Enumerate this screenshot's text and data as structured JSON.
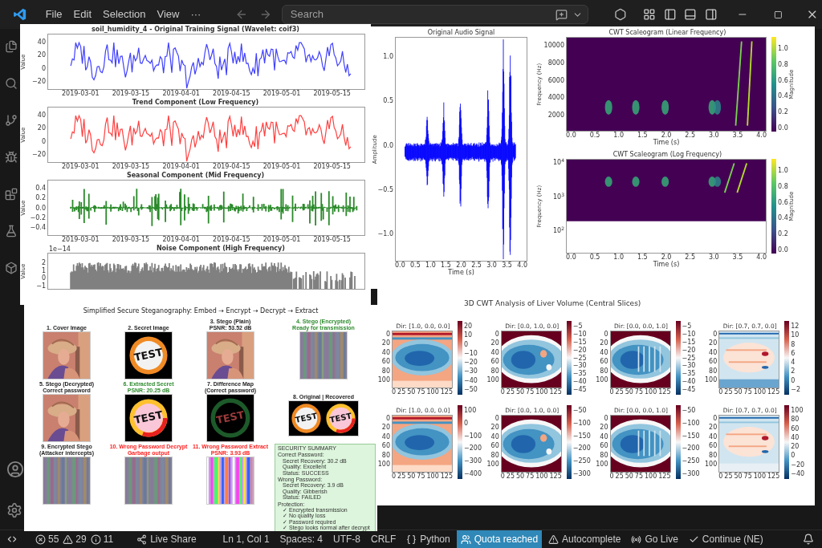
{
  "title_bar": {
    "menu": [
      "File",
      "Edit",
      "Selection",
      "View",
      "···"
    ],
    "search": {
      "placeholder": "Search"
    }
  },
  "decomposition_figure": {
    "panels": [
      {
        "title": "soil_humidity_4 - Original Training Signal (Wavelet: coif3)",
        "ylabel": "Value",
        "color": "#4040ff",
        "yticks": [
          "40",
          "20",
          "0",
          "−20"
        ],
        "xticks": [
          "2019-03-01",
          "2019-03-15",
          "2019-04-01",
          "2019-04-15",
          "2019-05-01",
          "2019-05-15"
        ]
      },
      {
        "title": "Trend Component (Low Frequency)",
        "ylabel": "Value",
        "color": "#ff4040",
        "yticks": [
          "40",
          "20",
          "0",
          "−20"
        ],
        "xticks": [
          "2019-03-01",
          "2019-03-15",
          "2019-04-01",
          "2019-04-15",
          "2019-05-01",
          "2019-05-15"
        ]
      },
      {
        "title": "Seasonal Component (Mid Frequency)",
        "ylabel": "Value",
        "color": "#2a8a2a",
        "yticks": [
          "0.4",
          "0.2",
          "0.0",
          "−0.2",
          "−0.4"
        ],
        "xticks": [
          "2019-03-01",
          "2019-03-15",
          "2019-04-01",
          "2019-04-15",
          "2019-05-01",
          "2019-05-15"
        ]
      },
      {
        "title": "Noise Component (High Frequency)",
        "ylabel": "Value",
        "color": "#808080",
        "offset_label": "1e−14",
        "yticks": [
          "2",
          "1",
          "0",
          "−1"
        ]
      }
    ]
  },
  "audio_figure": {
    "signal": {
      "title": "Original Audio Signal",
      "ylabel": "Amplitude",
      "xlabel": "Time (s)",
      "yticks": [
        "1.0",
        "0.5",
        "0.0",
        "−0.5",
        "−1.0"
      ],
      "xticks": [
        "0.0",
        "0.5",
        "1.0",
        "1.5",
        "2.0",
        "2.5",
        "3.0",
        "3.5",
        "4.0"
      ]
    },
    "scaleograms": [
      {
        "kind": "linear",
        "title": "CWT Scaleogram (Linear Frequency)",
        "ylabel": "Frequency (Hz)",
        "xlabel": "Time (s)",
        "yticks": [
          "10000",
          "8000",
          "6000",
          "4000",
          "2000"
        ],
        "xticks": [
          "0.0",
          "0.5",
          "1.0",
          "1.5",
          "2.0",
          "2.5",
          "3.0",
          "3.5",
          "4.0"
        ],
        "colorbar": {
          "label": "Magnitude",
          "ticks": [
            "1.0",
            "0.8",
            "0.6",
            "0.4",
            "0.2",
            "0.0"
          ]
        }
      },
      {
        "kind": "log",
        "title": "CWT Scaleogram (Log Frequency)",
        "ylabel": "Frequency (Hz)",
        "xlabel": "Time (s)",
        "yticks": [
          "10$^{4}$",
          "10$^{3}$",
          "10$^{2}$"
        ],
        "xticks": [
          "0.0",
          "0.5",
          "1.0",
          "1.5",
          "2.0",
          "2.5",
          "3.0",
          "3.5",
          "4.0"
        ],
        "colorbar": {
          "label": "Magnitude",
          "ticks": [
            "1.0",
            "0.8",
            "0.6",
            "0.4",
            "0.2",
            "0.0"
          ]
        }
      }
    ]
  },
  "cwt_3d_figure": {
    "title": "3D CWT Analysis of Liver Volume (Central Slices)",
    "panels": [
      {
        "title": "Dir: [1.0, 0.0, 0.0]",
        "yticks": [
          "0",
          "20",
          "40",
          "60",
          "80",
          "100"
        ],
        "xticks": [
          "0",
          "25",
          "50",
          "75",
          "100",
          "125"
        ],
        "colorbar": [
          "20",
          "10",
          "0",
          "−10",
          "−20",
          "−30",
          "−40",
          "−50"
        ]
      },
      {
        "title": "Dir: [0.0, 1.0, 0.0]",
        "yticks": [
          "0",
          "20",
          "40",
          "60",
          "80",
          "100"
        ],
        "xticks": [
          "0",
          "25",
          "50",
          "75",
          "100",
          "125"
        ],
        "colorbar": [
          "−5",
          "−10",
          "−15",
          "−20",
          "−25",
          "−30",
          "−35",
          "−40",
          "−45"
        ]
      },
      {
        "title": "Dir: [0.0, 0.0, 1.0]",
        "yticks": [
          "0",
          "20",
          "40",
          "60",
          "80",
          "100"
        ],
        "xticks": [
          "0",
          "25",
          "50",
          "75",
          "100",
          "125"
        ],
        "colorbar": [
          "−5",
          "−10",
          "−15",
          "−20",
          "−25",
          "−30",
          "−35",
          "−40",
          "−45"
        ]
      },
      {
        "title": "Dir: [0.7, 0.7, 0.0]",
        "yticks": [
          "0",
          "20",
          "40",
          "60",
          "80",
          "100"
        ],
        "xticks": [
          "0",
          "25",
          "50",
          "75",
          "100",
          "125"
        ],
        "colorbar": [
          "12",
          "10",
          "8",
          "6",
          "4",
          "2",
          "0",
          "−2"
        ]
      },
      {
        "title": "Dir: [1.0, 0.0, 0.0]",
        "yticks": [
          "0",
          "20",
          "40",
          "60",
          "80",
          "100"
        ],
        "xticks": [
          "0",
          "25",
          "50",
          "75",
          "100",
          "125"
        ],
        "colorbar": [
          "100",
          "0",
          "−100",
          "−200",
          "−300",
          "−400"
        ]
      },
      {
        "title": "Dir: [0.0, 1.0, 0.0]",
        "yticks": [
          "0",
          "20",
          "40",
          "60",
          "80",
          "100"
        ],
        "xticks": [
          "0",
          "25",
          "50",
          "75",
          "100",
          "125"
        ],
        "colorbar": [
          "−50",
          "−100",
          "−150",
          "−200",
          "−250",
          "−300"
        ]
      },
      {
        "title": "Dir: [0.0, 0.0, 1.0]",
        "yticks": [
          "0",
          "20",
          "40",
          "60",
          "80",
          "100"
        ],
        "xticks": [
          "0",
          "25",
          "50",
          "75",
          "100",
          "125"
        ],
        "colorbar": [
          "−50",
          "−100",
          "−150",
          "−200",
          "−250",
          "−300"
        ]
      },
      {
        "title": "Dir: [0.7, 0.7, 0.0]",
        "yticks": [
          "0",
          "20",
          "40",
          "60",
          "80",
          "100"
        ],
        "xticks": [
          "0",
          "25",
          "50",
          "75",
          "100",
          "125"
        ],
        "colorbar": [
          "100",
          "80",
          "60",
          "40",
          "20",
          "0",
          "−20",
          "−40"
        ]
      }
    ]
  },
  "stego_figure": {
    "title": "Simplified Secure Steganography: Embed → Encrypt → Decrypt → Extract",
    "cells": [
      {
        "title": "1. Cover Image",
        "color": "#222222"
      },
      {
        "kind": "sign",
        "title": "2. Secret Image",
        "color": "#222222",
        "text": "TEST"
      },
      {
        "title": "3. Stego (Plain)",
        "subtitle": "PSNR: 53.52 dB",
        "color": "#222222"
      },
      {
        "kind": "noise",
        "title": "4. Stego (Encrypted)",
        "subtitle": "Ready for transmission",
        "color": "#2e8b2e"
      },
      {
        "title": "5. Stego (Decrypted)",
        "subtitle": "Correct password",
        "color": "#222222"
      },
      {
        "kind": "recovered_sign",
        "title": "6. Extracted Secret",
        "subtitle": "PSNR: 20.25 dB",
        "color": "#2e8b2e",
        "text": "TEST"
      },
      {
        "kind": "diff",
        "title": "7. Difference Map",
        "subtitle": "(Correct password)",
        "color": "#222222",
        "text": "TEST"
      },
      {
        "kind": "pair",
        "title": "8. Original | Recovered",
        "color": "#222222",
        "texts": [
          "TEST",
          "TEST"
        ]
      },
      {
        "kind": "noise",
        "title": "9. Encrypted Stego",
        "subtitle": "(Attacker intercepts)",
        "color": "#222222"
      },
      {
        "kind": "noise",
        "title": "10. Wrong Password Decrypt",
        "subtitle": "Garbage output",
        "color": "#ff2020"
      },
      {
        "kind": "bright_noise",
        "title": "11. Wrong Password Extract",
        "subtitle": "PSNR: 3.93 dB",
        "color": "#ff2020"
      }
    ],
    "summary": {
      "title": "SECURITY SUMMARY",
      "sections": [
        {
          "heading": "Correct Password:",
          "lines": [
            "Secret Recovery: 30.2 dB",
            "Quality: Excellent",
            "Status: SUCCESS"
          ]
        },
        {
          "heading": "Wrong Password:",
          "lines": [
            "Secret Recovery: 3.9 dB",
            "Quality: Gibberish",
            "Status: FAILED"
          ]
        },
        {
          "heading": "Protection:",
          "lines": [
            "✓ Encrypted transmission",
            "✓ No quality loss",
            "✓ Password required",
            "✓ Stego looks normal after decrypt"
          ]
        }
      ]
    }
  },
  "status_bar": {
    "problems": {
      "errors": "55",
      "warnings": "29",
      "infos": "11"
    },
    "items": [
      {
        "kind": "share",
        "label": "Live Share",
        "highlighted": false
      },
      {
        "kind": "text",
        "label": "Ln 1, Col 1",
        "highlighted": false
      },
      {
        "kind": "text",
        "label": "Spaces: 4",
        "highlighted": false
      },
      {
        "kind": "text",
        "label": "UTF-8",
        "highlighted": false
      },
      {
        "kind": "text",
        "label": "CRLF",
        "highlighted": false
      },
      {
        "kind": "braces",
        "label": "Python",
        "highlighted": false
      },
      {
        "kind": "quota",
        "label": "Quota reached",
        "highlighted": true
      },
      {
        "kind": "warning",
        "label": "Autocomplete",
        "highlighted": false
      },
      {
        "kind": "broadcast",
        "label": "Go Live",
        "highlighted": false
      },
      {
        "kind": "check",
        "label": "Continue (NE)",
        "highlighted": false
      }
    ]
  }
}
